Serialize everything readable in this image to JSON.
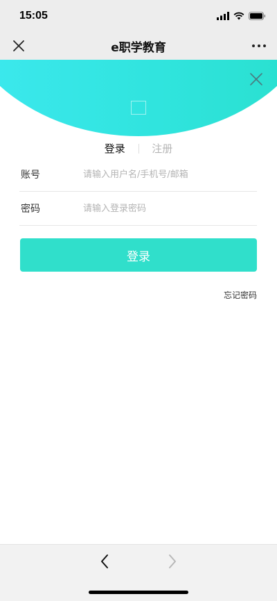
{
  "status_bar": {
    "time": "15:05",
    "icons": [
      "signal-icon",
      "wifi-icon",
      "battery-icon"
    ]
  },
  "nav": {
    "title": "e职学教育",
    "icons": [
      "close-icon",
      "more-icon"
    ]
  },
  "hero": {
    "colors": {
      "gradient_start": "#3ee9f0",
      "gradient_end": "#28dfcc"
    },
    "icons": [
      "close-icon",
      "logo-placeholder"
    ]
  },
  "tabs": {
    "login": "登录",
    "register": "注册",
    "active": "login"
  },
  "form": {
    "account": {
      "label": "账号",
      "placeholder": "请输入用户名/手机号/邮箱",
      "value": ""
    },
    "password": {
      "label": "密码",
      "placeholder": "请输入登录密码",
      "value": ""
    },
    "submit_label": "登录",
    "forgot_label": "忘记密码"
  },
  "toolbar": {
    "icons": [
      "back-icon",
      "forward-icon"
    ]
  },
  "colors": {
    "accent": "#30dfcb",
    "bar_bg": "#ededed"
  }
}
